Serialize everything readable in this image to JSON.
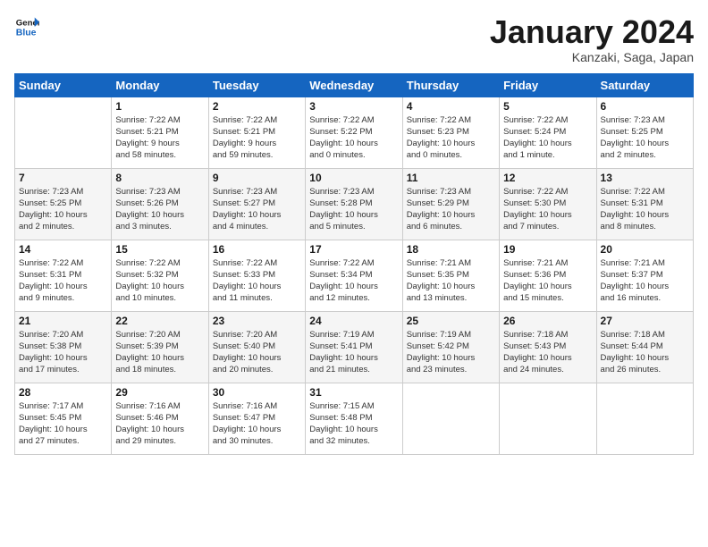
{
  "logo": {
    "text_general": "General",
    "text_blue": "Blue"
  },
  "header": {
    "month": "January 2024",
    "location": "Kanzaki, Saga, Japan"
  },
  "days_of_week": [
    "Sunday",
    "Monday",
    "Tuesday",
    "Wednesday",
    "Thursday",
    "Friday",
    "Saturday"
  ],
  "weeks": [
    [
      {
        "day": "",
        "info": ""
      },
      {
        "day": "1",
        "info": "Sunrise: 7:22 AM\nSunset: 5:21 PM\nDaylight: 9 hours\nand 58 minutes."
      },
      {
        "day": "2",
        "info": "Sunrise: 7:22 AM\nSunset: 5:21 PM\nDaylight: 9 hours\nand 59 minutes."
      },
      {
        "day": "3",
        "info": "Sunrise: 7:22 AM\nSunset: 5:22 PM\nDaylight: 10 hours\nand 0 minutes."
      },
      {
        "day": "4",
        "info": "Sunrise: 7:22 AM\nSunset: 5:23 PM\nDaylight: 10 hours\nand 0 minutes."
      },
      {
        "day": "5",
        "info": "Sunrise: 7:22 AM\nSunset: 5:24 PM\nDaylight: 10 hours\nand 1 minute."
      },
      {
        "day": "6",
        "info": "Sunrise: 7:23 AM\nSunset: 5:25 PM\nDaylight: 10 hours\nand 2 minutes."
      }
    ],
    [
      {
        "day": "7",
        "info": "Sunrise: 7:23 AM\nSunset: 5:25 PM\nDaylight: 10 hours\nand 2 minutes."
      },
      {
        "day": "8",
        "info": "Sunrise: 7:23 AM\nSunset: 5:26 PM\nDaylight: 10 hours\nand 3 minutes."
      },
      {
        "day": "9",
        "info": "Sunrise: 7:23 AM\nSunset: 5:27 PM\nDaylight: 10 hours\nand 4 minutes."
      },
      {
        "day": "10",
        "info": "Sunrise: 7:23 AM\nSunset: 5:28 PM\nDaylight: 10 hours\nand 5 minutes."
      },
      {
        "day": "11",
        "info": "Sunrise: 7:23 AM\nSunset: 5:29 PM\nDaylight: 10 hours\nand 6 minutes."
      },
      {
        "day": "12",
        "info": "Sunrise: 7:22 AM\nSunset: 5:30 PM\nDaylight: 10 hours\nand 7 minutes."
      },
      {
        "day": "13",
        "info": "Sunrise: 7:22 AM\nSunset: 5:31 PM\nDaylight: 10 hours\nand 8 minutes."
      }
    ],
    [
      {
        "day": "14",
        "info": "Sunrise: 7:22 AM\nSunset: 5:31 PM\nDaylight: 10 hours\nand 9 minutes."
      },
      {
        "day": "15",
        "info": "Sunrise: 7:22 AM\nSunset: 5:32 PM\nDaylight: 10 hours\nand 10 minutes."
      },
      {
        "day": "16",
        "info": "Sunrise: 7:22 AM\nSunset: 5:33 PM\nDaylight: 10 hours\nand 11 minutes."
      },
      {
        "day": "17",
        "info": "Sunrise: 7:22 AM\nSunset: 5:34 PM\nDaylight: 10 hours\nand 12 minutes."
      },
      {
        "day": "18",
        "info": "Sunrise: 7:21 AM\nSunset: 5:35 PM\nDaylight: 10 hours\nand 13 minutes."
      },
      {
        "day": "19",
        "info": "Sunrise: 7:21 AM\nSunset: 5:36 PM\nDaylight: 10 hours\nand 15 minutes."
      },
      {
        "day": "20",
        "info": "Sunrise: 7:21 AM\nSunset: 5:37 PM\nDaylight: 10 hours\nand 16 minutes."
      }
    ],
    [
      {
        "day": "21",
        "info": "Sunrise: 7:20 AM\nSunset: 5:38 PM\nDaylight: 10 hours\nand 17 minutes."
      },
      {
        "day": "22",
        "info": "Sunrise: 7:20 AM\nSunset: 5:39 PM\nDaylight: 10 hours\nand 18 minutes."
      },
      {
        "day": "23",
        "info": "Sunrise: 7:20 AM\nSunset: 5:40 PM\nDaylight: 10 hours\nand 20 minutes."
      },
      {
        "day": "24",
        "info": "Sunrise: 7:19 AM\nSunset: 5:41 PM\nDaylight: 10 hours\nand 21 minutes."
      },
      {
        "day": "25",
        "info": "Sunrise: 7:19 AM\nSunset: 5:42 PM\nDaylight: 10 hours\nand 23 minutes."
      },
      {
        "day": "26",
        "info": "Sunrise: 7:18 AM\nSunset: 5:43 PM\nDaylight: 10 hours\nand 24 minutes."
      },
      {
        "day": "27",
        "info": "Sunrise: 7:18 AM\nSunset: 5:44 PM\nDaylight: 10 hours\nand 26 minutes."
      }
    ],
    [
      {
        "day": "28",
        "info": "Sunrise: 7:17 AM\nSunset: 5:45 PM\nDaylight: 10 hours\nand 27 minutes."
      },
      {
        "day": "29",
        "info": "Sunrise: 7:16 AM\nSunset: 5:46 PM\nDaylight: 10 hours\nand 29 minutes."
      },
      {
        "day": "30",
        "info": "Sunrise: 7:16 AM\nSunset: 5:47 PM\nDaylight: 10 hours\nand 30 minutes."
      },
      {
        "day": "31",
        "info": "Sunrise: 7:15 AM\nSunset: 5:48 PM\nDaylight: 10 hours\nand 32 minutes."
      },
      {
        "day": "",
        "info": ""
      },
      {
        "day": "",
        "info": ""
      },
      {
        "day": "",
        "info": ""
      }
    ]
  ]
}
